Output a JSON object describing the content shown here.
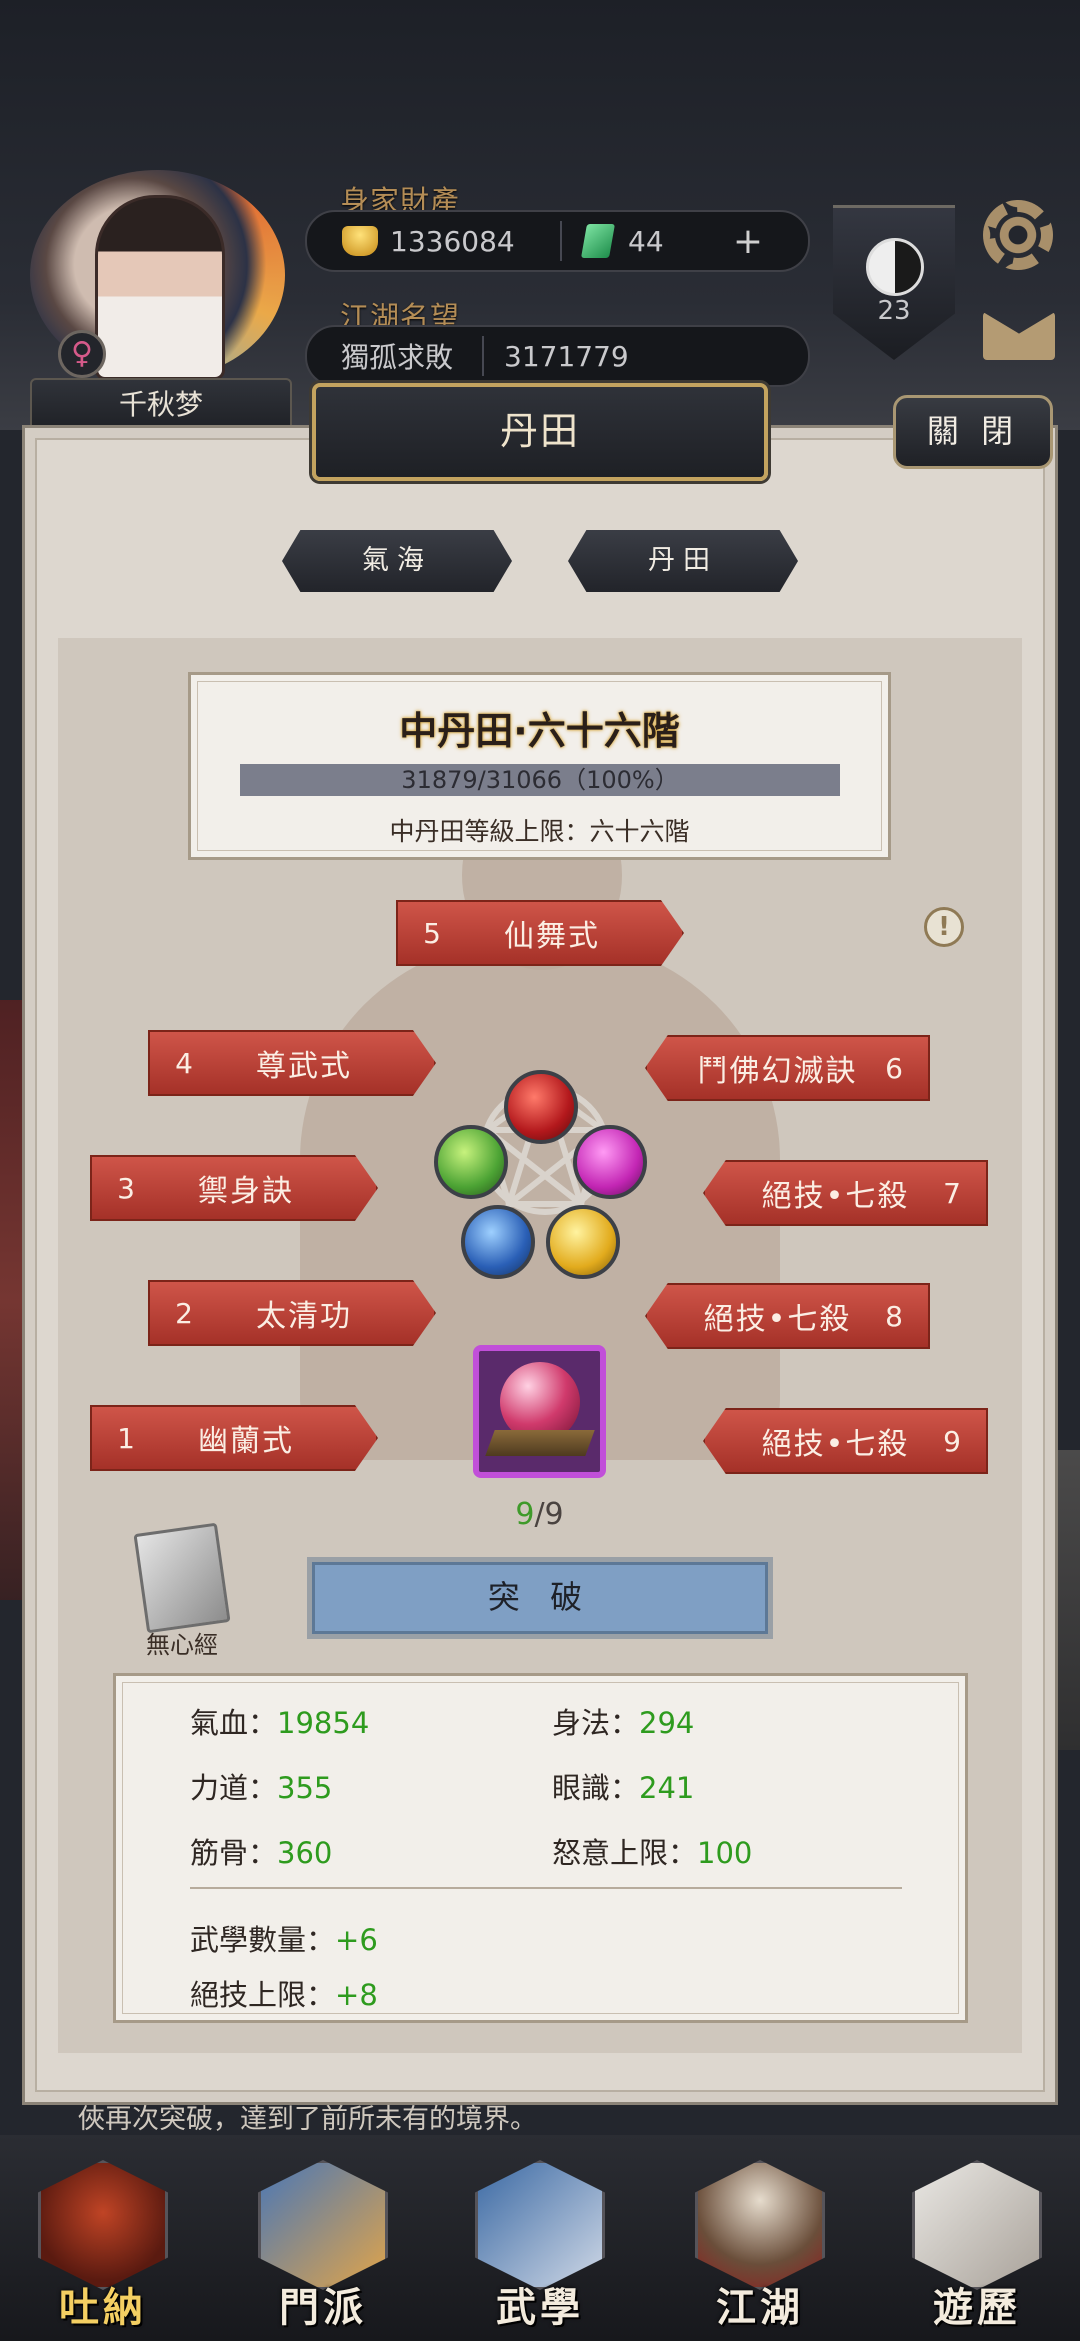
{
  "header": {
    "player_name": "千秋梦",
    "gender_symbol": "♀",
    "wealth_label": "身家財產",
    "gold": "1336084",
    "jade": "44",
    "add_symbol": "+",
    "fame_label": "江湖名望",
    "title": "獨孤求敗",
    "fame_value": "3171779",
    "rank_level": "23"
  },
  "panel": {
    "title": "丹田",
    "close_label": "關 閉",
    "tabs": [
      {
        "label": "氣海",
        "active": false
      },
      {
        "label": "丹田",
        "active": true
      }
    ]
  },
  "level": {
    "title": "中丹田·六十六階",
    "progress_text": "31879/31066（100%）",
    "progress_fraction": 1.0,
    "cap_text": "中丹田等級上限：六十六階"
  },
  "slots": [
    {
      "num": "1",
      "name": "幽蘭式"
    },
    {
      "num": "2",
      "name": "太清功"
    },
    {
      "num": "3",
      "name": "禦身訣"
    },
    {
      "num": "4",
      "name": "尊武式"
    },
    {
      "num": "5",
      "name": "仙舞式"
    },
    {
      "num": "6",
      "name": "鬥佛幻滅訣"
    },
    {
      "num": "7",
      "name": "絕技•七殺"
    },
    {
      "num": "8",
      "name": "絕技•七殺"
    },
    {
      "num": "9",
      "name": "絕技•七殺"
    }
  ],
  "info_symbol": "!",
  "core": {
    "have": "9",
    "sep": "/",
    "need": "9"
  },
  "manual": {
    "label": "無心經"
  },
  "breakthrough_label": "突 破",
  "stats": {
    "hp_label": "氣血：",
    "hp": "19854",
    "agility_label": "身法：",
    "agility": "294",
    "strength_label": "力道：",
    "strength": "355",
    "insight_label": "眼識：",
    "insight": "241",
    "bone_label": "筋骨：",
    "bone": "360",
    "rage_label": "怒意上限：",
    "rage": "100",
    "skill_count_label": "武學數量：",
    "skill_count": "+6",
    "ultimate_cap_label": "絕技上限：",
    "ultimate_cap": "+8"
  },
  "log_text": "俠再次突破，達到了前所未有的境界。",
  "nav": [
    {
      "label": "吐納",
      "active": true
    },
    {
      "label": "門派",
      "active": false
    },
    {
      "label": "武學",
      "active": false
    },
    {
      "label": "江湖",
      "active": false
    },
    {
      "label": "遊歷",
      "active": false
    }
  ]
}
